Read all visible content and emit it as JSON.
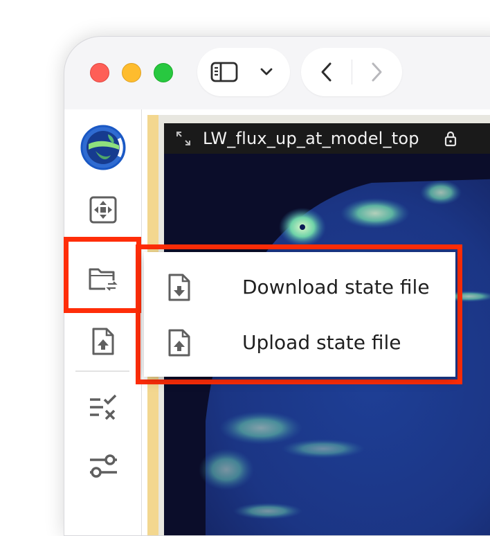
{
  "viz": {
    "title": "LW_flux_up_at_model_top"
  },
  "menu": {
    "items": [
      {
        "label": "Download state file",
        "icon": "file-download-icon"
      },
      {
        "label": "Upload state file",
        "icon": "file-upload-icon"
      }
    ]
  },
  "sidebar": {
    "items": [
      {
        "icon": "app-logo-globe-icon"
      },
      {
        "icon": "reset-camera-icon"
      },
      {
        "icon": "folder-transfer-icon"
      },
      {
        "icon": "file-upload-icon"
      },
      {
        "icon": "checklist-icon"
      },
      {
        "icon": "sliders-icon"
      }
    ]
  },
  "colors": {
    "highlight": "#ff2d08",
    "accent_bar": "#f3d78f",
    "title_bar": "#1a1a1a"
  }
}
